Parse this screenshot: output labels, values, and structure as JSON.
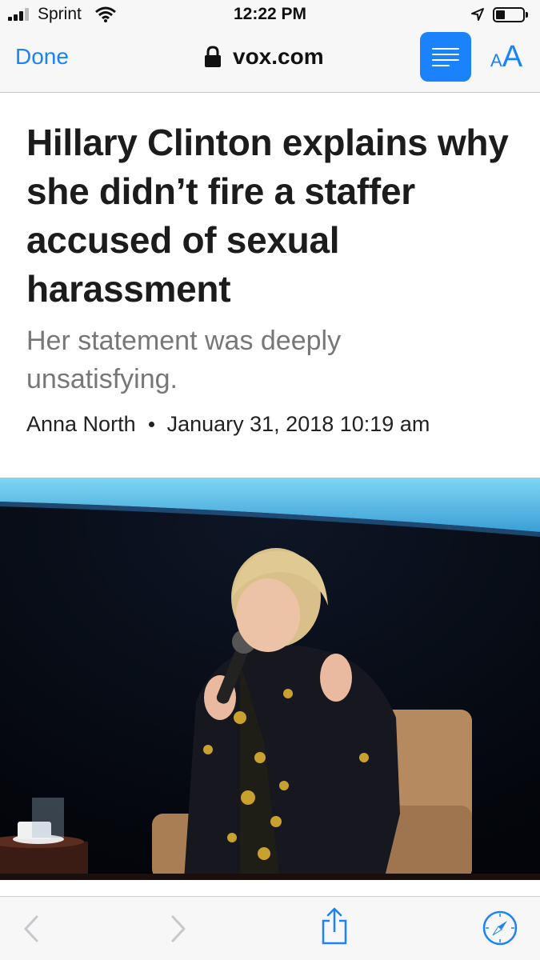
{
  "status_bar": {
    "carrier": "Sprint",
    "time": "12:22 PM",
    "signal_bars_filled": 3,
    "signal_bars_total": 4,
    "battery_level": 0.35
  },
  "nav": {
    "done_label": "Done",
    "url": "vox.com",
    "reader_icon": "reader-view-icon",
    "text_size_small": "A",
    "text_size_large": "A",
    "accent_color": "#1a82fb"
  },
  "article": {
    "headline": "Hillary Clinton explains why she didn’t fire a staffer accused of sexual harassment",
    "dek": "Her statement was deeply unsatisfying.",
    "author": "Anna North",
    "date": "January 31, 2018 10:19 am"
  },
  "toolbar": {
    "items": [
      "back-icon",
      "forward-icon",
      "share-icon",
      "compass-icon"
    ]
  }
}
